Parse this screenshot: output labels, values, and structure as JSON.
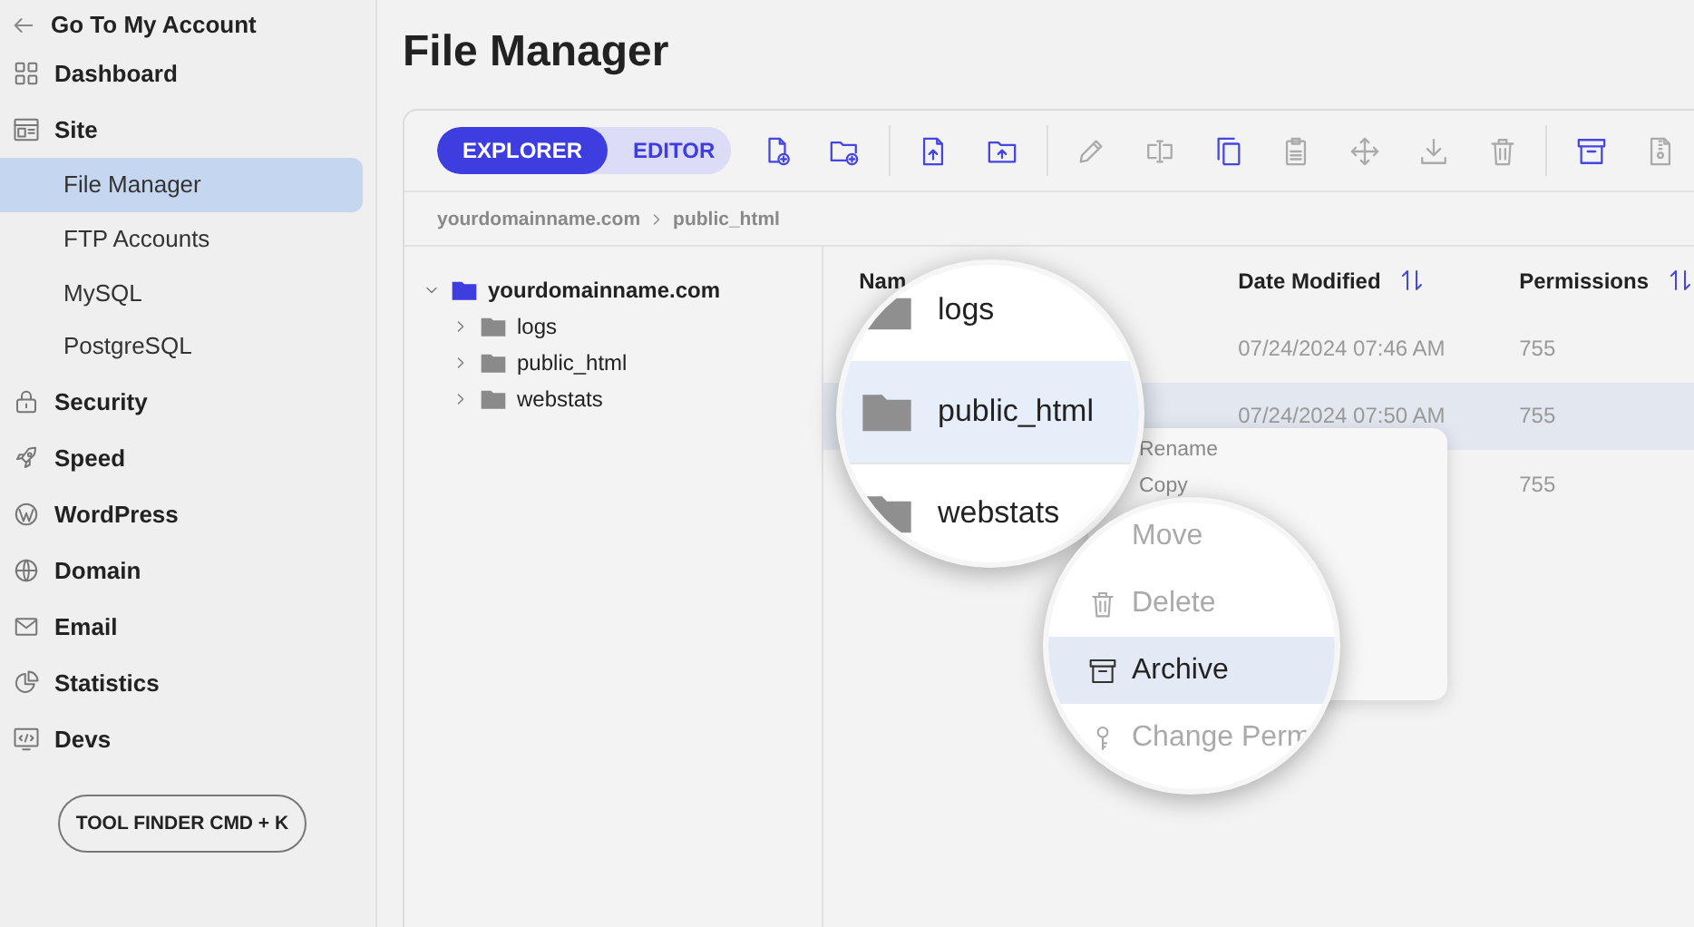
{
  "sidebar": {
    "back_link": "Go To My Account",
    "items": [
      {
        "label": "Dashboard",
        "kind": "section",
        "selected": false
      },
      {
        "label": "Site",
        "kind": "section",
        "selected": false
      },
      {
        "label": "File Manager",
        "kind": "sub",
        "selected": true
      },
      {
        "label": "FTP Accounts",
        "kind": "sub",
        "selected": false
      },
      {
        "label": "MySQL",
        "kind": "sub",
        "selected": false
      },
      {
        "label": "PostgreSQL",
        "kind": "sub",
        "selected": false
      },
      {
        "label": "Security",
        "kind": "section",
        "selected": false
      },
      {
        "label": "Speed",
        "kind": "section",
        "selected": false
      },
      {
        "label": "WordPress",
        "kind": "section",
        "selected": false
      },
      {
        "label": "Domain",
        "kind": "section",
        "selected": false
      },
      {
        "label": "Email",
        "kind": "section",
        "selected": false
      },
      {
        "label": "Statistics",
        "kind": "section",
        "selected": false
      },
      {
        "label": "Devs",
        "kind": "section",
        "selected": false
      }
    ],
    "tool_finder_button": "TOOL FINDER CMD + K"
  },
  "page_title": "File Manager",
  "tabs": [
    {
      "label": "EXPLORER",
      "selected": true
    },
    {
      "label": "EDITOR",
      "selected": false
    }
  ],
  "toolbar": {
    "groups": [
      [
        {
          "disabled": false
        },
        {
          "disabled": false
        }
      ],
      [
        {
          "disabled": false
        },
        {
          "disabled": false
        }
      ],
      [
        {
          "disabled": true
        },
        {
          "disabled": true
        },
        {
          "disabled": false
        },
        {
          "disabled": true
        },
        {
          "disabled": true
        },
        {
          "disabled": true
        },
        {
          "disabled": true
        }
      ],
      [
        {
          "disabled": false
        },
        {
          "disabled": true
        }
      ]
    ]
  },
  "breadcrumb": [
    "yourdomainname.com",
    "public_html"
  ],
  "tree": [
    {
      "name": "yourdomainname.com",
      "expanded": true,
      "children": [
        {
          "name": "logs",
          "expanded": false
        },
        {
          "name": "public_html",
          "expanded": false
        },
        {
          "name": "webstats",
          "expanded": false
        }
      ]
    }
  ],
  "table": {
    "columns": [
      {
        "label": "Nam"
      },
      {
        "label": "Date Modified",
        "sortable": true
      },
      {
        "label": "Permissions",
        "sortable": true
      }
    ],
    "rows": [
      {
        "date": "07/24/2024 07:46 AM",
        "permissions": "755",
        "selected": false
      },
      {
        "date": "07/24/2024 07:50 AM",
        "permissions": "755",
        "selected": true
      },
      {
        "permissions": "755",
        "selected": false
      }
    ]
  },
  "context_menu": {
    "items": [
      {
        "label": "Rename"
      },
      {
        "label": "Copy"
      }
    ]
  },
  "magnifier_files": [
    {
      "name": "logs",
      "selected": false
    },
    {
      "name": "public_html",
      "selected": true
    },
    {
      "name": "webstats",
      "selected": false
    }
  ],
  "magnifier_menu": [
    {
      "label": "Move",
      "selected": false
    },
    {
      "label": "Delete",
      "selected": false
    },
    {
      "label": "Archive",
      "selected": true
    },
    {
      "label": "Change Perm",
      "selected": false
    }
  ]
}
